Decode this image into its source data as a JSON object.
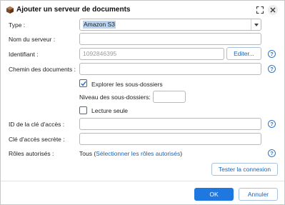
{
  "dialog": {
    "title": "Ajouter un serveur de documents",
    "icons": {
      "app": "document-server-icon",
      "expand": "expand-icon",
      "close": "close-icon"
    }
  },
  "form": {
    "type_label": "Type :",
    "type_value": "Amazon S3",
    "server_name_label": "Nom du serveur :",
    "server_name_value": "",
    "identifier_label": "Identifiant :",
    "identifier_value": "1092846395",
    "edit_button": "Editer...",
    "doc_path_label": "Chemin des documents :",
    "doc_path_value": "",
    "explore_subfolders_label": "Explorer les sous-dossiers",
    "explore_subfolders_checked": true,
    "subfolder_level_label": "Niveau des sous-dossiers:",
    "subfolder_level_value": "",
    "read_only_label": "Lecture seule",
    "read_only_checked": false,
    "access_key_id_label": "ID de la clé d'accès :",
    "access_key_id_value": "",
    "secret_key_label": "Clé d'accès secrète :",
    "secret_key_value": "",
    "roles_label": "Rôles autorisés :",
    "roles_prefix": "Tous (",
    "roles_link": "Sélectionner les rôles autorisés",
    "roles_suffix": ")",
    "test_connection_button": "Tester la connexion",
    "help_glyph": "?"
  },
  "footer": {
    "ok_button": "OK",
    "cancel_button": "Annuler"
  },
  "colors": {
    "accent": "#1e78e0",
    "link": "#1b63b7",
    "selection": "#b9d4f0"
  }
}
